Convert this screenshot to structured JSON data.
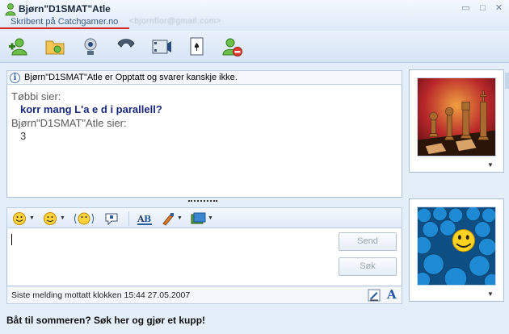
{
  "window": {
    "contact_name": "Bjørn\"D1SMAT\"Atle",
    "personal_message": "Skribent på Catchgamer.no",
    "email": "<bjornflor@gmail.com>",
    "controls": [
      "minimize-icon",
      "maximize-icon",
      "close-icon"
    ]
  },
  "toolbar": {
    "items": [
      {
        "icon": "invite-contact-icon"
      },
      {
        "icon": "send-files-icon"
      },
      {
        "icon": "webcam-icon"
      },
      {
        "icon": "call-phone-icon"
      },
      {
        "icon": "video-activities-icon"
      },
      {
        "icon": "games-icon"
      },
      {
        "icon": "block-contact-icon"
      }
    ]
  },
  "conversation": {
    "status_notice": "Bjørn\"D1SMAT\"Atle er Opptatt og svarer kanskje ikke.",
    "messages": [
      {
        "sender": "Tøbbi sier:",
        "text": "korr mang L'a e d i parallell?"
      },
      {
        "sender": "Bjørn\"D1SMAT\"Atle sier:",
        "text": "3"
      }
    ]
  },
  "compose": {
    "value": "",
    "send_label": "Send",
    "search_label": "Søk",
    "format_tools": [
      "emoticon-icon",
      "wink-icon",
      "nudge-icon",
      "voice-clip-icon",
      "font-icon",
      "handwriting-brush-icon",
      "background-icon"
    ]
  },
  "footer": {
    "last_message": "Siste melding mottatt klokken 15:44 27.05.2007"
  },
  "ad": {
    "text": "Båt til sommeren? Søk her og gjør et kupp!"
  },
  "colors": {
    "accent": "#2a5d9e",
    "underline": "#d9262a",
    "message_bold": "#1a2a7a"
  }
}
